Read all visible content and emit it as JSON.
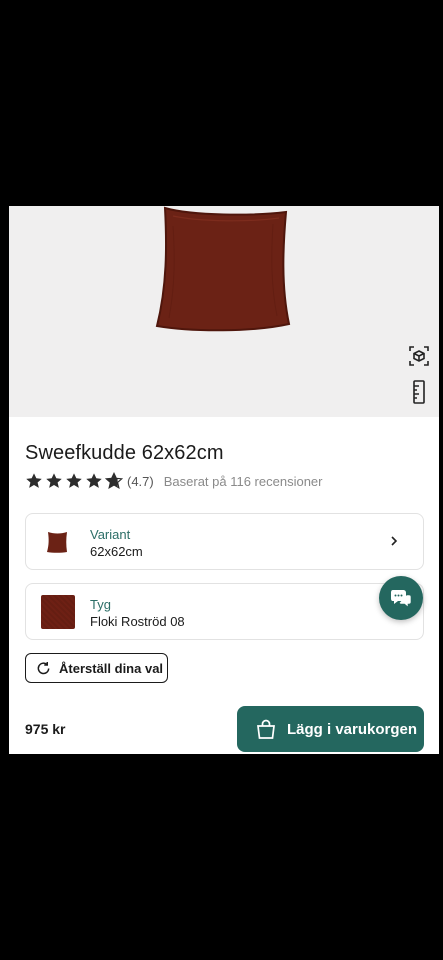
{
  "product": {
    "title": "Sweefkudde 62x62cm",
    "rating_value": "(4.7)",
    "rating_stars": 4.7,
    "reviews_text": "Baserat på 116 recensioner",
    "price": "975 kr"
  },
  "options": {
    "variant": {
      "label": "Variant",
      "value": "62x62cm",
      "icon": "pillow-thumbnail"
    },
    "fabric": {
      "label": "Tyg",
      "value": "Floki Roströd 08",
      "swatch_color": "#6e2014"
    }
  },
  "actions": {
    "reset_label": "Återställ dina val",
    "add_to_cart_label": "Lägg i varukorgen"
  },
  "icons": {
    "ar_view": "ar-cube-icon",
    "measure": "ruler-icon",
    "chat": "chat-bubble-icon",
    "cart": "shopping-bag-icon",
    "reset": "refresh-icon",
    "chevron": "chevron-right-icon"
  },
  "colors": {
    "brand": "#24675f",
    "product": "#6e2014",
    "hero_bg": "#f0efef"
  }
}
